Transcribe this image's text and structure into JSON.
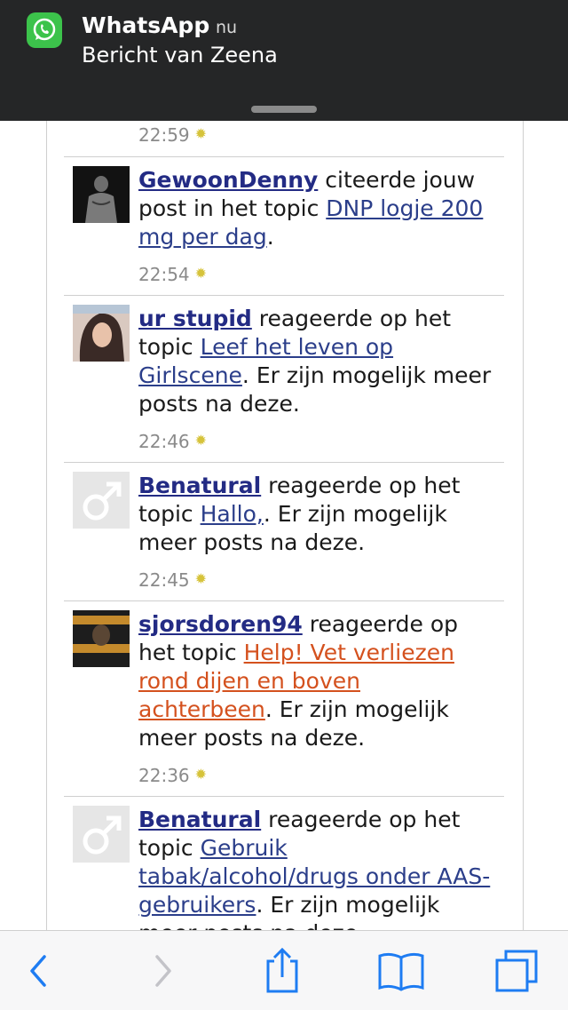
{
  "notification": {
    "app": "WhatsApp",
    "time": "nu",
    "message": "Bericht van Zeena"
  },
  "feed": {
    "top_time": "22:59",
    "items": [
      {
        "user": "GewoonDenny",
        "action": " citeerde jouw post in het topic ",
        "topic": "DNP logje 200 mg per dag",
        "suffix": ".",
        "time": "22:54"
      },
      {
        "user": "ur stupid",
        "action": " reageerde op het topic ",
        "topic": "Leef het leven op Girlscene",
        "suffix": ". Er zijn mogelijk meer posts na deze.",
        "time": "22:46"
      },
      {
        "user": "Benatural",
        "action": " reageerde op het topic ",
        "topic": "Hallo,",
        "suffix": ". Er zijn mogelijk meer posts na deze.",
        "time": "22:45"
      },
      {
        "user": "sjorsdoren94",
        "action": " reageerde op het topic ",
        "topic": "Help! Vet verliezen rond dijen en boven achterbeen",
        "suffix": ". Er zijn mogelijk meer posts na deze.",
        "time": "22:36"
      },
      {
        "user": "Benatural",
        "action": " reageerde op het topic ",
        "topic": "Gebruik tabak/alcohol/drugs onder AAS-gebruikers",
        "suffix": ". Er zijn mogelijk meer posts na deze.",
        "time": ""
      }
    ]
  },
  "colors": {
    "link": "#232b84",
    "visited_orange": "#d4511e",
    "whatsapp_green": "#3cc34b",
    "toolbar_blue": "#1e7cf2"
  },
  "toolbar_icons": [
    "back-icon",
    "forward-icon",
    "share-icon",
    "bookmarks-icon",
    "tabs-icon"
  ]
}
